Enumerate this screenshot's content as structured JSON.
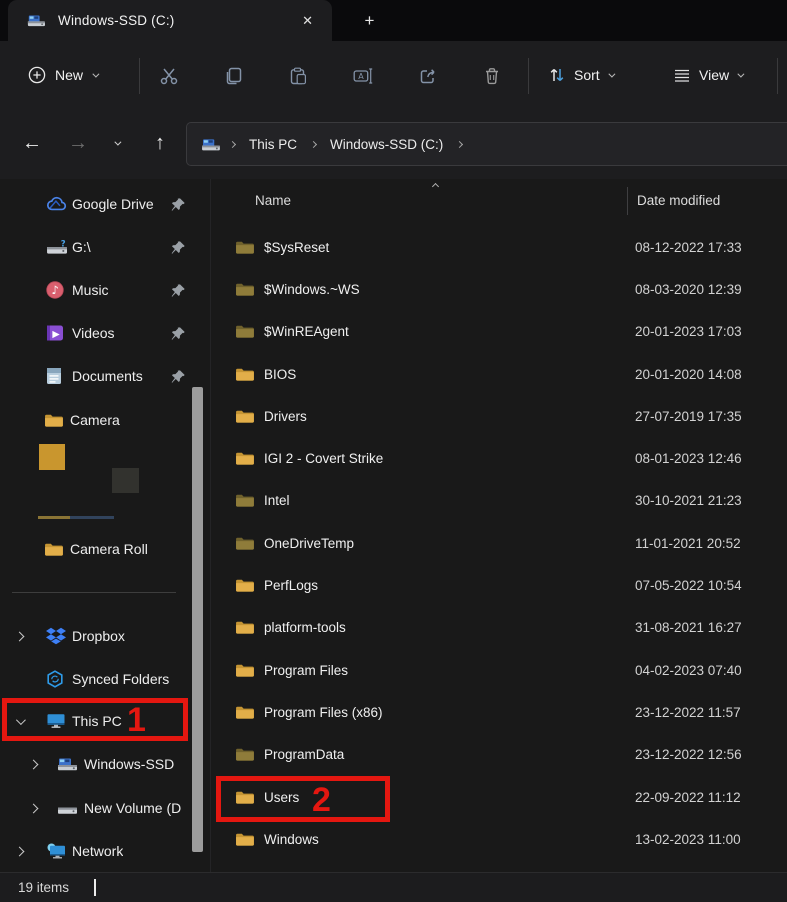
{
  "window": {
    "tab_title": "Windows-SSD (C:)"
  },
  "icons": {
    "close": "✕",
    "new_tab": "+",
    "back": "←",
    "forward": "→",
    "up": "↑"
  },
  "toolbar": {
    "new": "New",
    "sort": "Sort",
    "view": "View"
  },
  "breadcrumb": {
    "root": "This PC",
    "drive": "Windows-SSD (C:)"
  },
  "sidebar": {
    "items": [
      {
        "label": "Google Drive",
        "pinned": true
      },
      {
        "label": "G:\\",
        "pinned": true
      },
      {
        "label": "Music",
        "pinned": true
      },
      {
        "label": "Videos",
        "pinned": true
      },
      {
        "label": "Documents",
        "pinned": true
      },
      {
        "label": "Camera",
        "pinned": false
      },
      {
        "label": "Camera Roll",
        "pinned": false
      },
      {
        "label": "Dropbox",
        "pinned": false
      },
      {
        "label": "Synced Folders",
        "pinned": false
      },
      {
        "label": "This PC",
        "pinned": false
      },
      {
        "label": "Windows-SSD",
        "pinned": false
      },
      {
        "label": "New Volume (D",
        "pinned": false
      },
      {
        "label": "Network",
        "pinned": false
      }
    ]
  },
  "filelist": {
    "columns": {
      "name": "Name",
      "date": "Date modified"
    },
    "rows": [
      {
        "name": "$SysReset",
        "date": "08-12-2022 17:33",
        "dim": true
      },
      {
        "name": "$Windows.~WS",
        "date": "08-03-2020 12:39",
        "dim": true
      },
      {
        "name": "$WinREAgent",
        "date": "20-01-2023 17:03",
        "dim": true
      },
      {
        "name": "BIOS",
        "date": "20-01-2020 14:08",
        "dim": false
      },
      {
        "name": "Drivers",
        "date": "27-07-2019 17:35",
        "dim": false
      },
      {
        "name": "IGI 2 - Covert Strike",
        "date": "08-01-2023 12:46",
        "dim": false
      },
      {
        "name": "Intel",
        "date": "30-10-2021 21:23",
        "dim": true
      },
      {
        "name": "OneDriveTemp",
        "date": "11-01-2021 20:52",
        "dim": true
      },
      {
        "name": "PerfLogs",
        "date": "07-05-2022 10:54",
        "dim": false
      },
      {
        "name": "platform-tools",
        "date": "31-08-2021 16:27",
        "dim": false
      },
      {
        "name": "Program Files",
        "date": "04-02-2023 07:40",
        "dim": false
      },
      {
        "name": "Program Files (x86)",
        "date": "23-12-2022 11:57",
        "dim": false
      },
      {
        "name": "ProgramData",
        "date": "23-12-2022 12:56",
        "dim": true
      },
      {
        "name": "Users",
        "date": "22-09-2022 11:12",
        "dim": false
      },
      {
        "name": "Windows",
        "date": "13-02-2023 11:00",
        "dim": false
      }
    ]
  },
  "annotations": {
    "step1": "1",
    "step2": "2"
  },
  "statusbar": {
    "count": "19 items"
  },
  "colors": {
    "annotation_red": "#e41710",
    "folder_gold": "#e2ae49",
    "folder_dim": "#8f7c3a",
    "chrome_bg": "#1d1d1f",
    "content_bg": "#191919"
  }
}
